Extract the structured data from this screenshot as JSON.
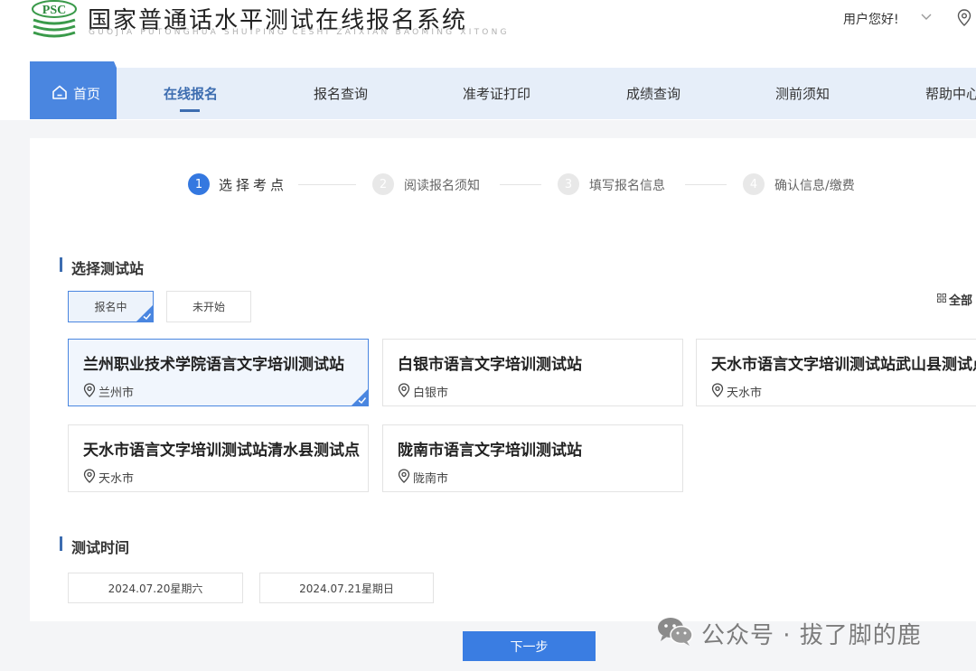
{
  "header": {
    "logo_text": "PSC",
    "title": "国家普通话水平测试在线报名系统",
    "title_pinyin": "GUOJIA PUTONGHUA SHUIPING CESHI ZAIXIAN BAOMING XITONG",
    "user_greeting": "用户您好!",
    "user_menu_icon": "chevron-down-icon",
    "location_icon": "location-pin-icon"
  },
  "nav": {
    "home": {
      "label": "首页",
      "icon": "home-icon"
    },
    "items": [
      {
        "label": "在线报名",
        "active": true
      },
      {
        "label": "报名查询"
      },
      {
        "label": "准考证打印"
      },
      {
        "label": "成绩查询"
      },
      {
        "label": "测前须知"
      },
      {
        "label": "帮助中心"
      }
    ]
  },
  "steps": [
    {
      "number": "1",
      "label": "选择考点",
      "active": true
    },
    {
      "number": "2",
      "label": "阅读报名须知"
    },
    {
      "number": "3",
      "label": "填写报名信息"
    },
    {
      "number": "4",
      "label": "确认信息/缴费"
    }
  ],
  "station_section": {
    "title": "选择测试站",
    "filters": [
      {
        "label": "报名中",
        "selected": true
      },
      {
        "label": "未开始"
      }
    ],
    "view_all": "全部"
  },
  "stations": [
    {
      "name": "兰州职业技术学院语言文字培训测试站",
      "city": "兰州市",
      "selected": true
    },
    {
      "name": "白银市语言文字培训测试站",
      "city": "白银市"
    },
    {
      "name": "天水市语言文字培训测试站武山县测试点",
      "city": "天水市"
    },
    {
      "name": "天水市语言文字培训测试站清水县测试点",
      "city": "天水市"
    },
    {
      "name": "陇南市语言文字培训测试站",
      "city": "陇南市"
    }
  ],
  "time_section": {
    "title": "测试时间",
    "dates": [
      "2024.07.20星期六",
      "2024.07.21星期日"
    ]
  },
  "next_button": "下一步",
  "watermark": {
    "text": "公众号 · 拔了脚的鹿",
    "icon": "wechat-icon"
  },
  "colors": {
    "primary": "#3a7de2",
    "nav_bg": "#e6eef9",
    "accent_text": "#3d6db0"
  }
}
